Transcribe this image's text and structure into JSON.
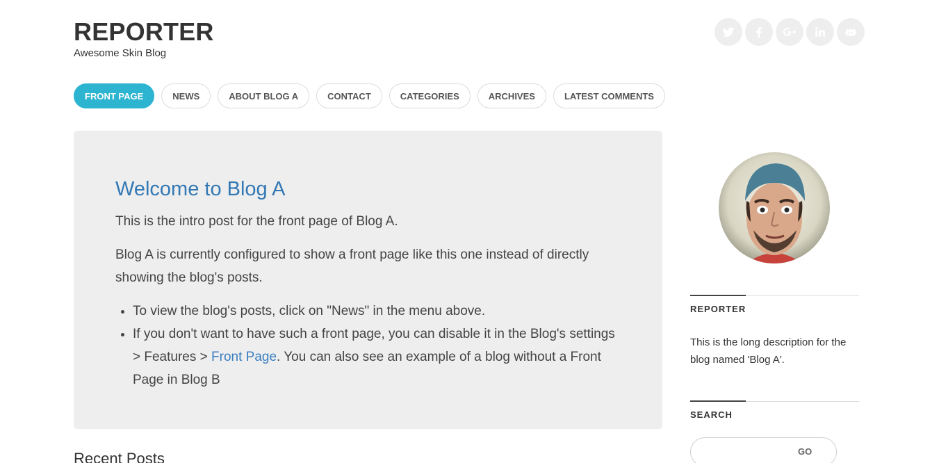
{
  "header": {
    "title": "REPORTER",
    "tagline": "Awesome Skin Blog"
  },
  "social": [
    {
      "icon": "twitter-icon"
    },
    {
      "icon": "facebook-icon"
    },
    {
      "icon": "google-plus-icon"
    },
    {
      "icon": "linkedin-icon"
    },
    {
      "icon": "github-icon"
    }
  ],
  "nav": {
    "items": [
      {
        "label": "FRONT PAGE",
        "active": true
      },
      {
        "label": "NEWS"
      },
      {
        "label": "ABOUT BLOG A"
      },
      {
        "label": "CONTACT"
      },
      {
        "label": "CATEGORIES"
      },
      {
        "label": "ARCHIVES"
      },
      {
        "label": "LATEST COMMENTS"
      }
    ]
  },
  "intro": {
    "title": "Welcome to Blog A",
    "p1": "This is the intro post for the front page of Blog A.",
    "p2": "Blog A is currently configured to show a front page like this one instead of directly showing the blog's posts.",
    "li1": "To view the blog's posts, click on \"News\" in the menu above.",
    "li2_before": "If you don't want to have such a front page, you can disable it in the Blog's settings > Features > ",
    "li2_link": "Front Page",
    "li2_after": ". You can also see an example of a blog without a Front Page in Blog B"
  },
  "recent": {
    "title": "Recent Posts"
  },
  "sidebar": {
    "about_title": "REPORTER",
    "about_text": "This is the long description for the blog named 'Blog A'.",
    "search_title": "SEARCH",
    "search_placeholder": "",
    "search_button": "GO"
  },
  "colors": {
    "accent": "#2db4d0",
    "link": "#3278b4",
    "box_bg": "#eeeeee"
  }
}
